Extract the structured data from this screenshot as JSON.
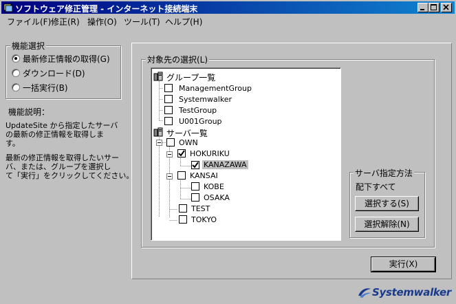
{
  "window": {
    "title": "ソフトウェア修正管理 - インターネット接続端末"
  },
  "menu": [
    "ファイル(F)",
    "修正(R)",
    "操作(O)",
    "ツール(T)",
    "ヘルプ(H)"
  ],
  "function_select": {
    "title": "機能選択",
    "options": [
      {
        "label": "最新修正情報の取得(G)",
        "selected": true
      },
      {
        "label": "ダウンロード(D)",
        "selected": false
      },
      {
        "label": "一括実行(B)",
        "selected": false
      }
    ]
  },
  "description": {
    "title": "機能説明：",
    "para1": [
      "UpdateSite から指定したサーバ",
      "の最新の修正情報を取得しま",
      "す。"
    ],
    "para2": [
      "最新の修正情報を取得したいサー",
      "バ、または、グループを選択し",
      "て「実行」をクリックしてください。"
    ]
  },
  "target": {
    "title": "対象先の選択(L)",
    "group_root": "グループ一覧",
    "groups": [
      {
        "label": "ManagementGroup",
        "checked": false
      },
      {
        "label": "Systemwalker",
        "checked": false
      },
      {
        "label": "TestGroup",
        "checked": false
      },
      {
        "label": "U001Group",
        "checked": false
      }
    ],
    "server_root": "サーバ一覧",
    "servers": {
      "own": {
        "label": "OWN",
        "checked": false
      },
      "hokuriku": {
        "label": "HOKURIKU",
        "checked": true
      },
      "kanazawa": {
        "label": "KANAZAWA",
        "checked": true
      },
      "kansai": {
        "label": "KANSAI",
        "checked": false
      },
      "kobe": {
        "label": "KOBE",
        "checked": false
      },
      "osaka": {
        "label": "OSAKA",
        "checked": false
      },
      "test": {
        "label": "TEST",
        "checked": false
      },
      "tokyo": {
        "label": "TOKYO",
        "checked": false
      }
    }
  },
  "server_spec": {
    "title": "サーバ指定方法",
    "mode": "配下すべて",
    "select_button": "選択する(S)",
    "deselect_button": "選択解除(N)"
  },
  "execute_button": "実行(X)",
  "logo_text": "Systemwalker",
  "colors": {
    "titlebar_start": "#000080",
    "titlebar_end": "#1084d0",
    "face": "#c0c0c0",
    "logo": "#1a3a8c"
  }
}
